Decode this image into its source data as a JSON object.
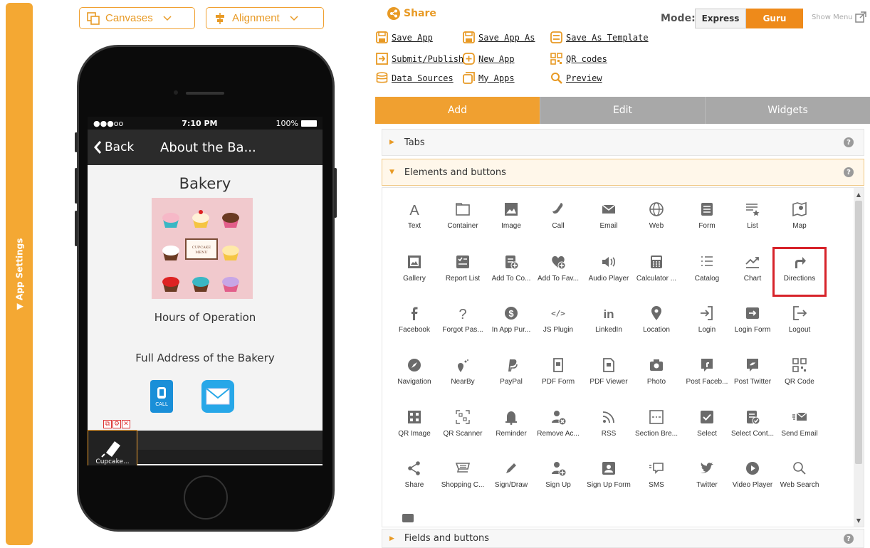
{
  "left_panel": {
    "label": "▼ App Settings"
  },
  "top_controls": {
    "canvases": "Canvases",
    "alignment": "Alignment"
  },
  "phone": {
    "status_left": "●●●oo",
    "status_time": "7:10 PM",
    "status_battery": "100%",
    "back_label": "Back",
    "nav_title": "About the Ba...",
    "bakery_title": "Bakery",
    "cupcake_menu": "CUPCAKE\nMENU",
    "hours": "Hours of Operation",
    "address": "Full Address of the Bakery",
    "call_label": "CALL",
    "tab_item_label": "Cupcake..."
  },
  "header": {
    "share": "Share",
    "mode_label": "Mode:",
    "mode_express": "Express",
    "mode_guru": "Guru",
    "show_menu": "Show Menu"
  },
  "actions": [
    {
      "label": "Save App",
      "icon": "save-icon"
    },
    {
      "label": "Save App As",
      "icon": "save-as-icon"
    },
    {
      "label": "Save As Template",
      "icon": "template-icon"
    },
    {
      "label": "Submit/Publish",
      "icon": "submit-icon"
    },
    {
      "label": "New App",
      "icon": "plus-icon"
    },
    {
      "label": "QR codes",
      "icon": "qr-icon"
    },
    {
      "label": "Data Sources",
      "icon": "database-icon"
    },
    {
      "label": "My Apps",
      "icon": "apps-icon"
    },
    {
      "label": "Preview",
      "icon": "magnifier-icon"
    }
  ],
  "panel_tabs": [
    "Add",
    "Edit",
    "Widgets"
  ],
  "sections": {
    "tabs": "Tabs",
    "elements": "Elements and buttons",
    "fields": "Fields and buttons"
  },
  "widgets": [
    [
      "Text",
      "Container",
      "Image",
      "Call",
      "Email",
      "Web",
      "Form",
      "List",
      "Map"
    ],
    [
      "Gallery",
      "Report List",
      "Add To Co...",
      "Add To Fav...",
      "Audio Player",
      "Calculator ...",
      "Catalog",
      "Chart",
      "Directions"
    ],
    [
      "Facebook",
      "Forgot Pas...",
      "In App Pur...",
      "JS Plugin",
      "LinkedIn",
      "Location",
      "Login",
      "Login Form",
      "Logout"
    ],
    [
      "Navigation",
      "NearBy",
      "PayPal",
      "PDF Form",
      "PDF Viewer",
      "Photo",
      "Post Faceb...",
      "Post Twitter",
      "QR Code"
    ],
    [
      "QR Image",
      "QR Scanner",
      "Reminder",
      "Remove Ac...",
      "RSS",
      "Section Bre...",
      "Select",
      "Select Cont...",
      "Send Email"
    ],
    [
      "Share",
      "Shopping C...",
      "Sign/Draw",
      "Sign Up",
      "Sign Up Form",
      "SMS",
      "Twitter",
      "Video Player",
      "Web Search"
    ]
  ],
  "colors": {
    "accent": "#f0a030",
    "guru": "#ee8a1a",
    "highlight": "#d7232a",
    "icon": "#6b6b6b"
  }
}
